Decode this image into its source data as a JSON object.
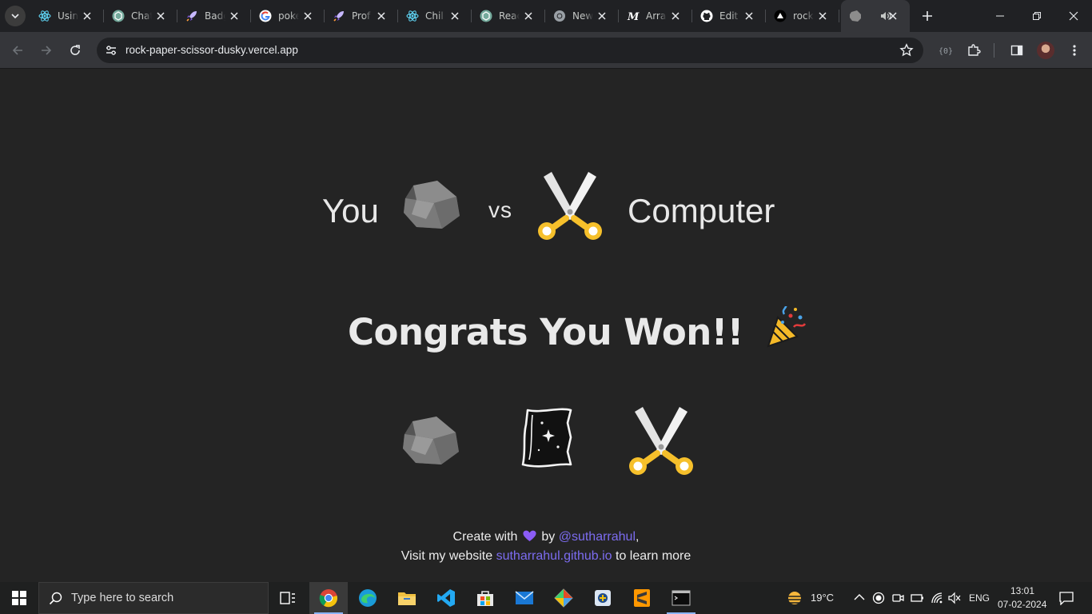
{
  "browser": {
    "tabs": [
      {
        "title": "Using",
        "icon": "react-icon"
      },
      {
        "title": "Chat",
        "icon": "chatgpt-icon"
      },
      {
        "title": "Badge",
        "icon": "rocket-icon"
      },
      {
        "title": "poke",
        "icon": "google-icon"
      },
      {
        "title": "Prof",
        "icon": "rocket-icon"
      },
      {
        "title": "Chil",
        "icon": "react-icon"
      },
      {
        "title": "Reac",
        "icon": "chatgpt-icon"
      },
      {
        "title": "New",
        "icon": "chrome-icon"
      },
      {
        "title": "Arra",
        "icon": "m-icon"
      },
      {
        "title": "Edit",
        "icon": "github-icon"
      },
      {
        "title": "rock",
        "icon": "vercel-icon"
      },
      {
        "title": "",
        "icon": "rock-icon",
        "active": true,
        "audio": true
      }
    ],
    "url": "rock-paper-scissor-dusky.vercel.app"
  },
  "game": {
    "you_label": "You",
    "vs_label": "vs",
    "computer_label": "Computer",
    "you_choice": "rock",
    "computer_choice": "scissors",
    "result_text": "Congrats You Won!!",
    "options": [
      "rock",
      "paper",
      "scissors"
    ]
  },
  "footer": {
    "line1_prefix": "Create with",
    "line1_by": "by",
    "author_handle": "@sutharrahul",
    "line1_suffix": ",",
    "line2_prefix": "Visit my website",
    "website": "sutharrahul.github.io",
    "line2_suffix": "to learn more"
  },
  "taskbar": {
    "search_placeholder": "Type here to search",
    "weather_temp": "19°C",
    "language": "ENG",
    "time": "13:01",
    "date": "07-02-2024"
  },
  "colors": {
    "page_bg": "#242424",
    "link": "#7c6cf0",
    "scissor_handle": "#f6c02b"
  }
}
